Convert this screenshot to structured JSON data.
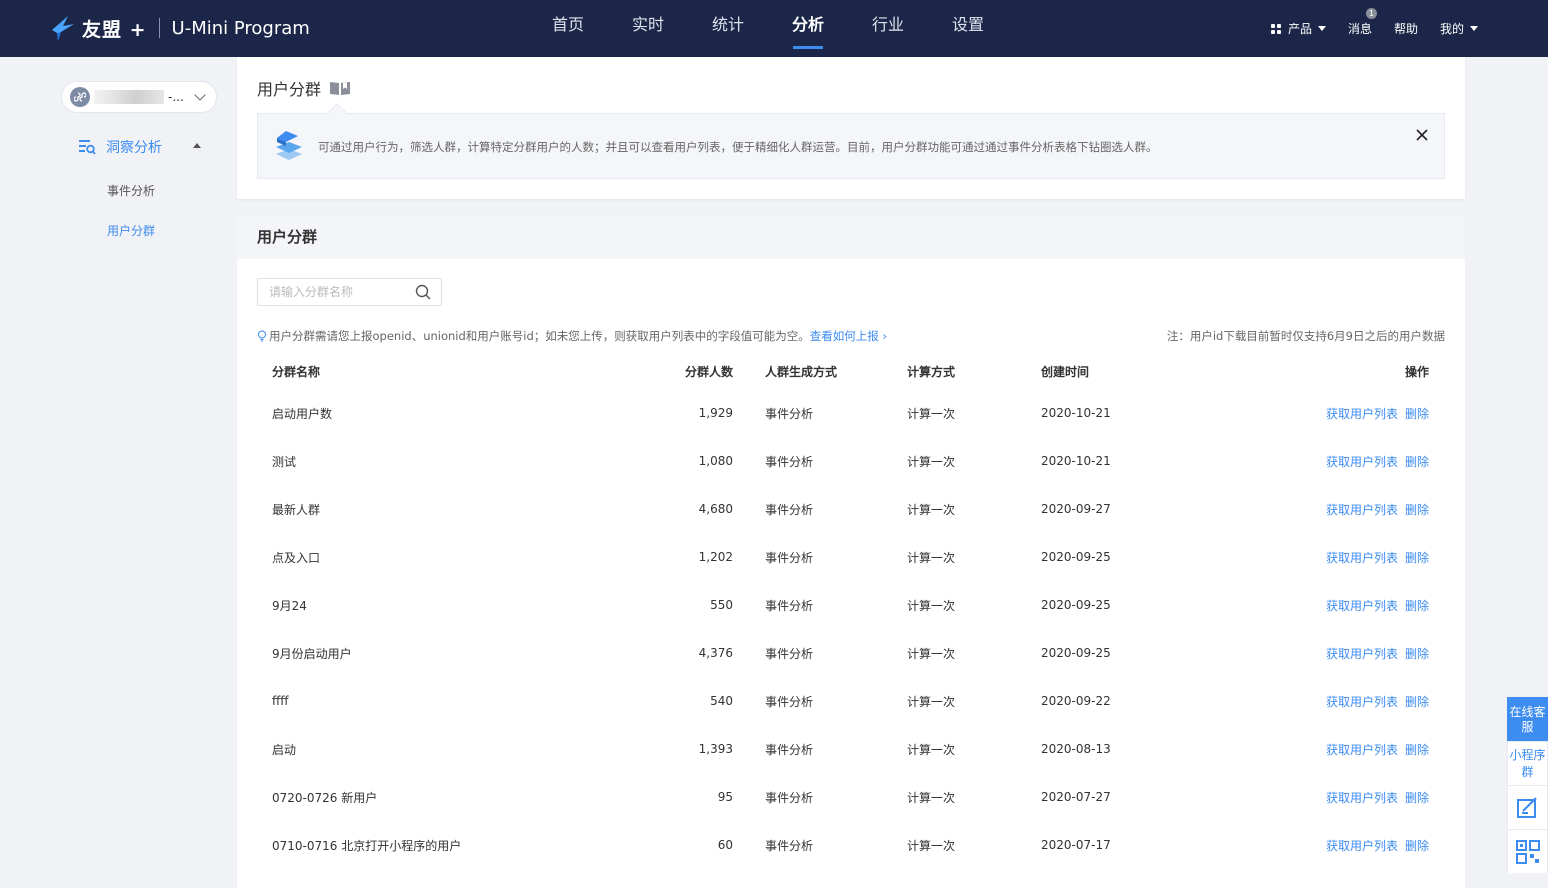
{
  "header": {
    "brand": "友盟 +",
    "product": "U-Mini Program",
    "nav": [
      "首页",
      "实时",
      "统计",
      "分析",
      "行业",
      "设置"
    ],
    "active_nav_index": 3,
    "right": {
      "products": "产品",
      "messages": "消息",
      "message_badge": "1",
      "help": "帮助",
      "mine": "我的"
    }
  },
  "sidebar": {
    "app_name_suffix": "-...",
    "group_label": "洞察分析",
    "items": [
      {
        "label": "事件分析",
        "active": false
      },
      {
        "label": "用户分群",
        "active": true
      }
    ]
  },
  "intro": {
    "title": "用户分群",
    "notice": "可通过用户行为，筛选人群，计算特定分群用户的人数；并且可以查看用户列表，便于精细化人群运营。目前，用户分群功能可通过通过事件分析表格下钻圈选人群。"
  },
  "segments": {
    "title": "用户分群",
    "search_placeholder": "请输入分群名称",
    "tip": "用户分群需请您上报openid、unionid和用户账号id；如未您上传，则获取用户列表中的字段值可能为空。",
    "tip_link": "查看如何上报",
    "note": "注：用户id下载目前暂时仅支持6月9日之后的用户数据",
    "columns": {
      "name": "分群名称",
      "count": "分群人数",
      "generation": "人群生成方式",
      "calc": "计算方式",
      "created": "创建时间",
      "ops": "操作"
    },
    "op_get_list": "获取用户列表",
    "op_delete": "删除",
    "rows": [
      {
        "name": "启动用户数",
        "count": "1,929",
        "generation": "事件分析",
        "calc": "计算一次",
        "created": "2020-10-21"
      },
      {
        "name": "测试",
        "count": "1,080",
        "generation": "事件分析",
        "calc": "计算一次",
        "created": "2020-10-21"
      },
      {
        "name": "最新人群",
        "count": "4,680",
        "generation": "事件分析",
        "calc": "计算一次",
        "created": "2020-09-27"
      },
      {
        "name": "点及入口",
        "count": "1,202",
        "generation": "事件分析",
        "calc": "计算一次",
        "created": "2020-09-25"
      },
      {
        "name": "9月24",
        "count": "550",
        "generation": "事件分析",
        "calc": "计算一次",
        "created": "2020-09-25"
      },
      {
        "name": "9月份启动用户",
        "count": "4,376",
        "generation": "事件分析",
        "calc": "计算一次",
        "created": "2020-09-25"
      },
      {
        "name": "ffff",
        "count": "540",
        "generation": "事件分析",
        "calc": "计算一次",
        "created": "2020-09-22"
      },
      {
        "name": "启动",
        "count": "1,393",
        "generation": "事件分析",
        "calc": "计算一次",
        "created": "2020-08-13"
      },
      {
        "name": "0720-0726 新用户",
        "count": "95",
        "generation": "事件分析",
        "calc": "计算一次",
        "created": "2020-07-27"
      },
      {
        "name": "0710-0716 北京打开小程序的用户",
        "count": "60",
        "generation": "事件分析",
        "calc": "计算一次",
        "created": "2020-07-17"
      }
    ]
  },
  "floating": {
    "online_service": "在线客服",
    "mini_group": "小程序群",
    "feedback_icon": "edit-icon",
    "qrcode_icon": "qrcode-icon"
  },
  "colors": {
    "topbar": "#1b2648",
    "accent": "#3d8cf0",
    "page_bg": "#f1f2f6"
  }
}
